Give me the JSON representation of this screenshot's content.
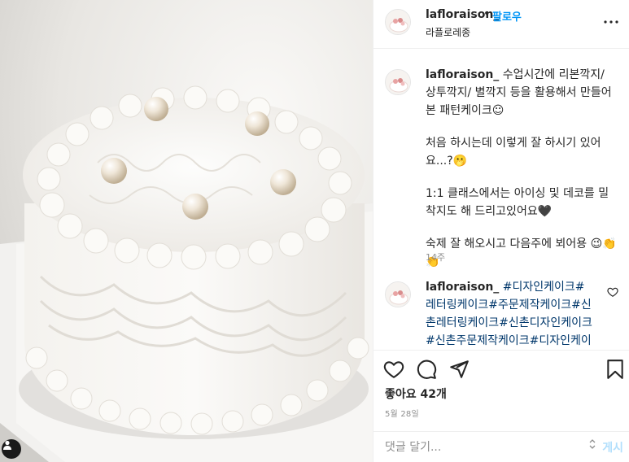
{
  "post": {
    "username": "lafloraison_",
    "dot": "•",
    "follow_label": "팔로우",
    "location": "라플로레종"
  },
  "caption": {
    "username": "lafloraison_",
    "para1": "수업시간에 리본깍지/ 상투깍지/ 별깍지 등을 활용해서 만들어본 패턴케이크☺",
    "para2": "처음 하시는데 이렇게 잘 하시기 있어요...?🫢",
    "para3": "1:1 클래스에서는 아이싱 및 데코를 밀착지도 해 드리고있어요🖤",
    "para4": "숙제 잘 해오시고 다음주에 뵈어용 😉👏👏",
    "time": "14주"
  },
  "comment": {
    "username": "lafloraison_",
    "hashtags": "#디자인케이크#레터링케이크#주문제작케이크#신촌레터링케이크#신촌디자인케이크#신촌주문제작케이크#디자인케이크클래스#레터링케이크클래스"
  },
  "actions": {
    "likes": "좋아요 42개",
    "date": "5월 28일"
  },
  "add_comment": {
    "placeholder": "댓글 달기...",
    "post_label": "게시"
  },
  "icons": {
    "more": "more-horizontal-icon",
    "like": "heart-icon",
    "comment": "comment-bubble-icon",
    "share": "paper-plane-icon",
    "save": "bookmark-icon",
    "tag_user": "user-tag-icon"
  },
  "colors": {
    "follow": "#0095f6",
    "hashtag": "#00376b",
    "muted": "#8e8e8e",
    "post_disabled": "#b2dffc"
  }
}
